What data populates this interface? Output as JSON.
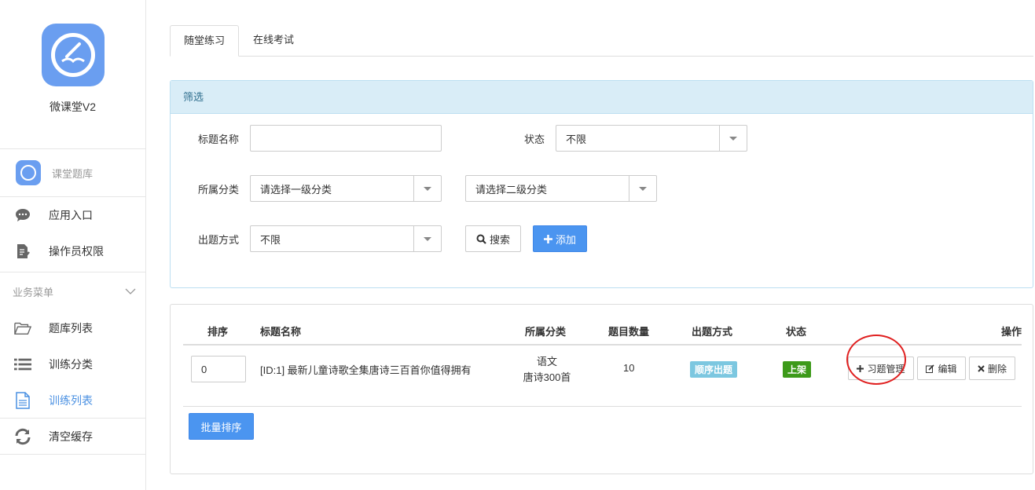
{
  "brand": {
    "name": "微课堂V2"
  },
  "module": {
    "label": "课堂题库"
  },
  "nav": {
    "top_items": [
      {
        "label": "应用入口",
        "icon": "chat-bubble-icon"
      },
      {
        "label": "操作员权限",
        "icon": "file-edit-icon"
      }
    ],
    "section_title": "业务菜单",
    "section_items": [
      {
        "label": "题库列表",
        "icon": "folder-open-icon"
      },
      {
        "label": "训练分类",
        "icon": "list-icon"
      },
      {
        "label": "训练列表",
        "icon": "file-text-icon",
        "active": true
      },
      {
        "label": "清空缓存",
        "icon": "refresh-icon"
      }
    ]
  },
  "tabs": [
    {
      "label": "随堂练习",
      "active": true
    },
    {
      "label": "在线考试",
      "active": false
    }
  ],
  "filter": {
    "heading": "筛选",
    "title_label": "标题名称",
    "title_value": "",
    "status_label": "状态",
    "status_value": "不限",
    "category_label": "所属分类",
    "category1_value": "请选择一级分类",
    "category2_value": "请选择二级分类",
    "mode_label": "出题方式",
    "mode_value": "不限",
    "search_label": "搜索",
    "add_label": "添加"
  },
  "table": {
    "headers": {
      "sort": "排序",
      "title": "标题名称",
      "category": "所属分类",
      "count": "题目数量",
      "mode": "出题方式",
      "status": "状态",
      "actions": "操作"
    },
    "rows": [
      {
        "sort": "0",
        "title": "[ID:1] 最新儿童诗歌全集唐诗三百首你值得拥有",
        "category_main": "语文",
        "category_sub": "唐诗300首",
        "count": "10",
        "mode": "顺序出题",
        "status": "上架",
        "btn_manage": "习题管理",
        "btn_edit": "编辑",
        "btn_delete": "删除"
      }
    ],
    "batch_sort_label": "批量排序"
  },
  "colors": {
    "primary": "#4b95f0",
    "info_heading_bg": "#d9edf7",
    "label_info": "#7cc7e0",
    "label_success": "#3d9a1a",
    "annotation_circle": "#e02020"
  }
}
